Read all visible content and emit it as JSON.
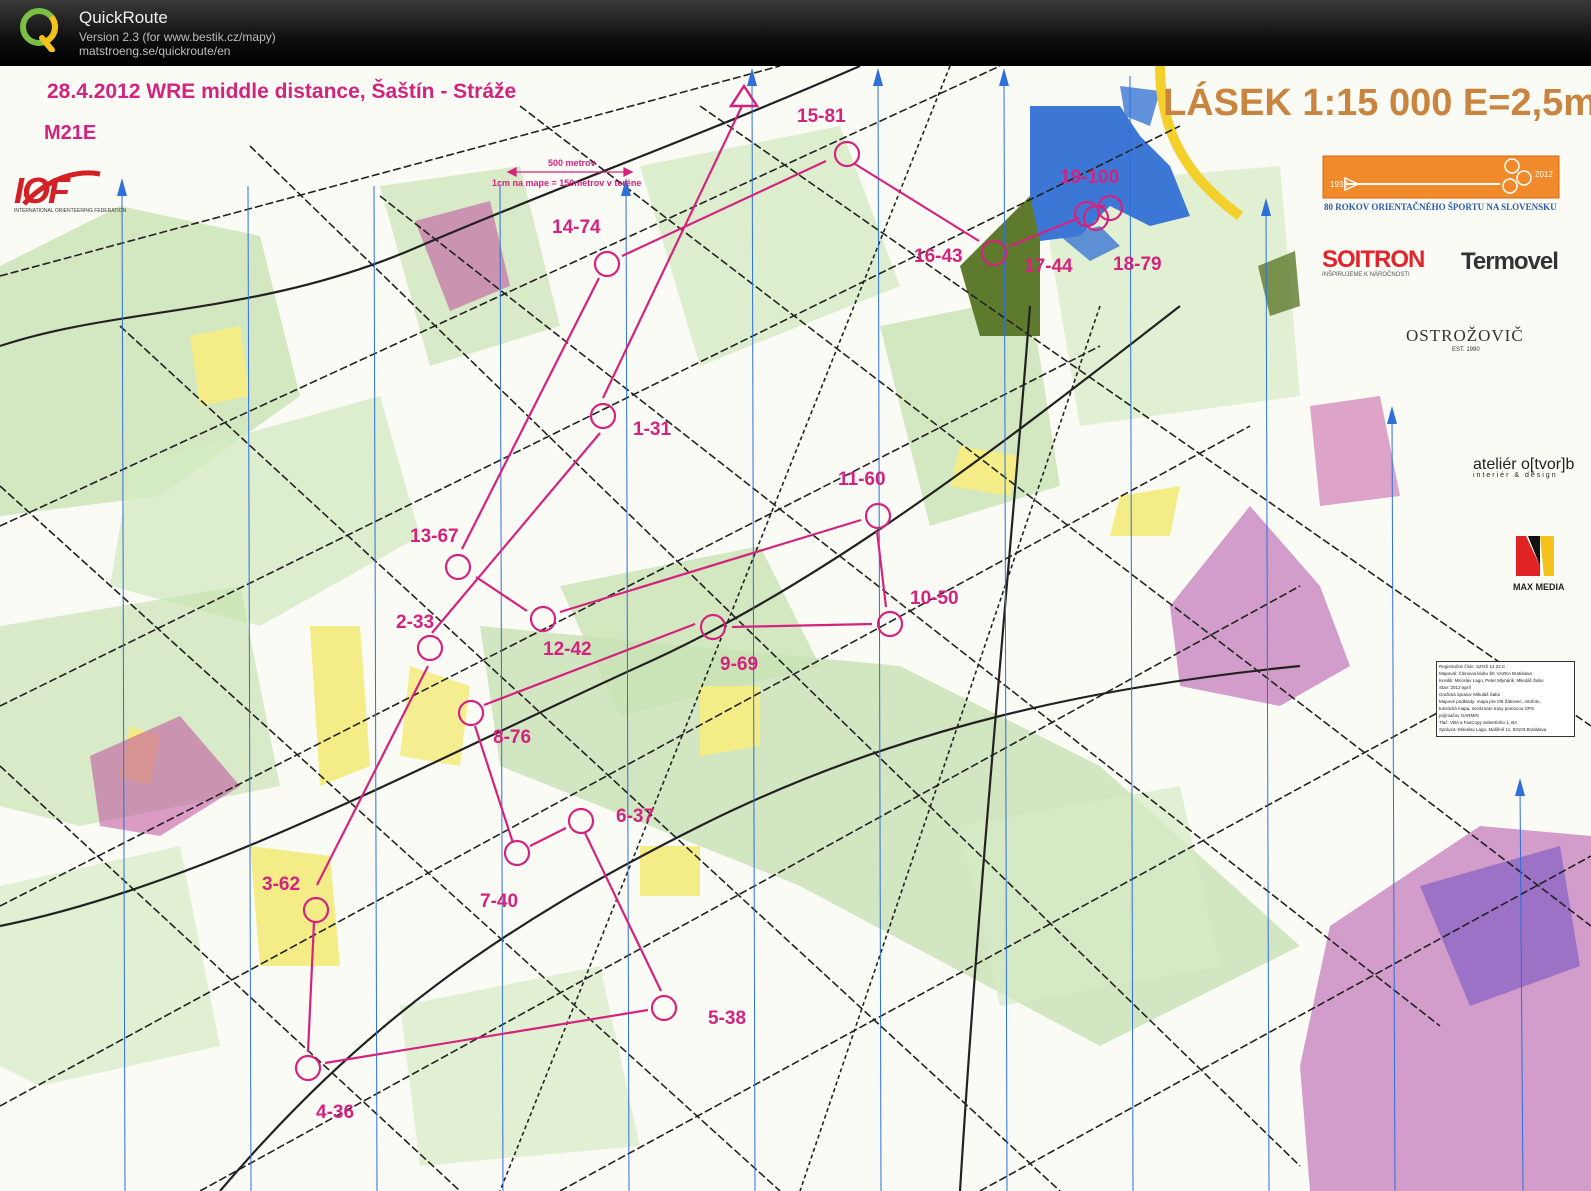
{
  "app": {
    "name": "QuickRoute",
    "version": "Version 2.3  (for www.bestik.cz/mapy)",
    "url": "matstroeng.se/quickroute/en"
  },
  "map": {
    "event_title": "28.4.2012  WRE middle distance, Šaštín - Stráže",
    "course": "M21E",
    "title": "LÁSEK 1:15 000 E=2,5m",
    "scale_bar_top": "500 metrov",
    "scale_bar_bottom": "1cm na mape = 150metrov v  teréne",
    "iof_logo": "IOF",
    "iof_sub": "INTERNATIONAL ORIENTEERING FEDERATION",
    "anniversary": {
      "text": "80 ROKOV ORIENTAČNÉHO ŠPORTU NA SLOVENSKU",
      "year_start": "1932",
      "year_end": "2012",
      "color": "#f08a2a"
    },
    "sponsors": {
      "soitron": "SOITRON",
      "soitron_sub": "INŠPIRUJEME K NÁROČNOSTI",
      "termovel": "Termovel",
      "ostrozovic": "OSTROŽOVIČ",
      "ostrozovic_sub": "EST. 1990",
      "atelier": "ateliér o[tvor]b",
      "atelier_sub": "interiér & design",
      "maxmedia": "MAX MEDIA"
    },
    "info_box": [
      "Registračné číslo: SZOŠ 12.22.C",
      "Mapoval: Členovia klubu ŠK VAZKA Bratislava",
      "Kreslili: Miroslav Lago, Peter Mlynárik, Mikuláš Šabo",
      "Stav: 2012-apríl",
      "Grafická úprava: Mikuláš Šabo",
      "Mapové podklady: mapa pre OB Žákovec, ortofoto,",
      "turistická mapa, nezáznam trasy pomocou GPS",
      "prijímačov GARMIN",
      "Tlač: VBA a FaxCopy Sebertínho 1, BA",
      "Správca: Miroslav Lago, Mašlíně 11, 83103 Bratislava"
    ],
    "colors": {
      "course": "#d4237e",
      "forest": "#c9e3b4",
      "open": "#f4ec86",
      "water": "#3c77d6",
      "dark_green": "#5e7a2c",
      "north_lines": "#2f6fd8"
    },
    "controls": [
      {
        "label": "1-31"
      },
      {
        "label": "2-33"
      },
      {
        "label": "3-62"
      },
      {
        "label": "4-36"
      },
      {
        "label": "5-38"
      },
      {
        "label": "6-37"
      },
      {
        "label": "7-40"
      },
      {
        "label": "8-76"
      },
      {
        "label": "9-69"
      },
      {
        "label": "10-50"
      },
      {
        "label": "11-60"
      },
      {
        "label": "12-42"
      },
      {
        "label": "13-67"
      },
      {
        "label": "14-74"
      },
      {
        "label": "15-81"
      },
      {
        "label": "16-43"
      },
      {
        "label": "17-44"
      },
      {
        "label": "18-79"
      },
      {
        "label": "19-100"
      }
    ]
  }
}
